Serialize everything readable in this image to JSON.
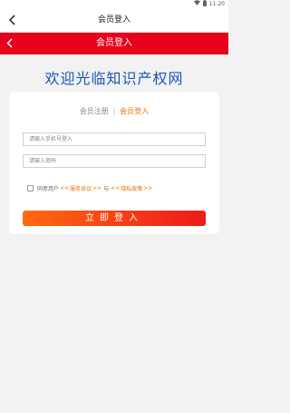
{
  "statusbar": {
    "time": "11:20",
    "wifi_icon": "wifi-icon",
    "battery_icon": "battery-icon"
  },
  "appbar": {
    "title": "会员登入",
    "back_icon": "chevron-left-icon"
  },
  "header": {
    "title": "会员登入",
    "back_icon": "chevron-left-icon",
    "color": "#e8001c"
  },
  "welcome": "欢迎光临知识产权网",
  "tabs": {
    "register": "会员注册",
    "separator": "|",
    "login": "会员登入"
  },
  "form": {
    "phone_placeholder": "请输入手机号登入",
    "password_placeholder": "请输入密码"
  },
  "agreement": {
    "prefix": "同意用户",
    "service_open": "<<",
    "service": "服务协议",
    "service_close": ">>",
    "and": "与",
    "privacy_open": "<<",
    "privacy": "隐私政策",
    "privacy_close": ">>"
  },
  "login_button": "立即登入",
  "colors": {
    "accent": "#e8700a",
    "brand_blue": "#1a55b5",
    "button_start": "#ff6a10",
    "button_end": "#ee1a1a"
  }
}
